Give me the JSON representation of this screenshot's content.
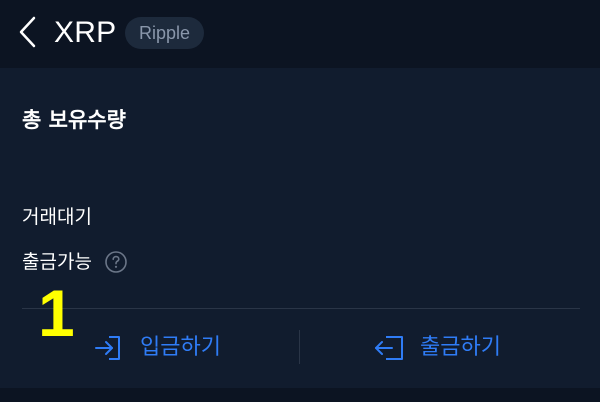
{
  "header": {
    "title": "XRP",
    "badge": "Ripple"
  },
  "card": {
    "title": "총 보유수량",
    "rows": [
      {
        "label": "거래대기"
      },
      {
        "label": "출금가능"
      }
    ],
    "actions": {
      "deposit_label": "입금하기",
      "withdraw_label": "출금하기"
    }
  },
  "annotation": {
    "marker": "1"
  },
  "icons": {
    "back": "chevron-left-icon",
    "help": "question-circle-icon",
    "deposit": "sign-in-icon",
    "withdraw": "sign-out-icon"
  },
  "colors": {
    "background": "#0c1422",
    "card": "#111c2e",
    "accent": "#2f7cf6",
    "annotation": "#ffff00"
  }
}
